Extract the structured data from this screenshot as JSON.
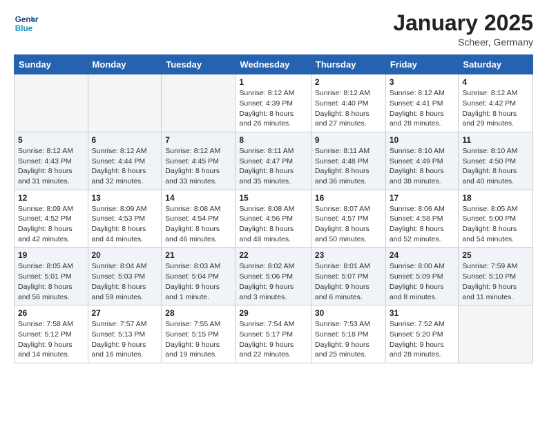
{
  "logo": {
    "line1": "General",
    "line2": "Blue"
  },
  "title": "January 2025",
  "subtitle": "Scheer, Germany",
  "weekdays": [
    "Sunday",
    "Monday",
    "Tuesday",
    "Wednesday",
    "Thursday",
    "Friday",
    "Saturday"
  ],
  "weeks": [
    [
      {
        "day": "",
        "info": ""
      },
      {
        "day": "",
        "info": ""
      },
      {
        "day": "",
        "info": ""
      },
      {
        "day": "1",
        "info": "Sunrise: 8:12 AM\nSunset: 4:39 PM\nDaylight: 8 hours and 26 minutes."
      },
      {
        "day": "2",
        "info": "Sunrise: 8:12 AM\nSunset: 4:40 PM\nDaylight: 8 hours and 27 minutes."
      },
      {
        "day": "3",
        "info": "Sunrise: 8:12 AM\nSunset: 4:41 PM\nDaylight: 8 hours and 28 minutes."
      },
      {
        "day": "4",
        "info": "Sunrise: 8:12 AM\nSunset: 4:42 PM\nDaylight: 8 hours and 29 minutes."
      }
    ],
    [
      {
        "day": "5",
        "info": "Sunrise: 8:12 AM\nSunset: 4:43 PM\nDaylight: 8 hours and 31 minutes."
      },
      {
        "day": "6",
        "info": "Sunrise: 8:12 AM\nSunset: 4:44 PM\nDaylight: 8 hours and 32 minutes."
      },
      {
        "day": "7",
        "info": "Sunrise: 8:12 AM\nSunset: 4:45 PM\nDaylight: 8 hours and 33 minutes."
      },
      {
        "day": "8",
        "info": "Sunrise: 8:11 AM\nSunset: 4:47 PM\nDaylight: 8 hours and 35 minutes."
      },
      {
        "day": "9",
        "info": "Sunrise: 8:11 AM\nSunset: 4:48 PM\nDaylight: 8 hours and 36 minutes."
      },
      {
        "day": "10",
        "info": "Sunrise: 8:10 AM\nSunset: 4:49 PM\nDaylight: 8 hours and 38 minutes."
      },
      {
        "day": "11",
        "info": "Sunrise: 8:10 AM\nSunset: 4:50 PM\nDaylight: 8 hours and 40 minutes."
      }
    ],
    [
      {
        "day": "12",
        "info": "Sunrise: 8:09 AM\nSunset: 4:52 PM\nDaylight: 8 hours and 42 minutes."
      },
      {
        "day": "13",
        "info": "Sunrise: 8:09 AM\nSunset: 4:53 PM\nDaylight: 8 hours and 44 minutes."
      },
      {
        "day": "14",
        "info": "Sunrise: 8:08 AM\nSunset: 4:54 PM\nDaylight: 8 hours and 46 minutes."
      },
      {
        "day": "15",
        "info": "Sunrise: 8:08 AM\nSunset: 4:56 PM\nDaylight: 8 hours and 48 minutes."
      },
      {
        "day": "16",
        "info": "Sunrise: 8:07 AM\nSunset: 4:57 PM\nDaylight: 8 hours and 50 minutes."
      },
      {
        "day": "17",
        "info": "Sunrise: 8:06 AM\nSunset: 4:58 PM\nDaylight: 8 hours and 52 minutes."
      },
      {
        "day": "18",
        "info": "Sunrise: 8:05 AM\nSunset: 5:00 PM\nDaylight: 8 hours and 54 minutes."
      }
    ],
    [
      {
        "day": "19",
        "info": "Sunrise: 8:05 AM\nSunset: 5:01 PM\nDaylight: 8 hours and 56 minutes."
      },
      {
        "day": "20",
        "info": "Sunrise: 8:04 AM\nSunset: 5:03 PM\nDaylight: 8 hours and 59 minutes."
      },
      {
        "day": "21",
        "info": "Sunrise: 8:03 AM\nSunset: 5:04 PM\nDaylight: 9 hours and 1 minute."
      },
      {
        "day": "22",
        "info": "Sunrise: 8:02 AM\nSunset: 5:06 PM\nDaylight: 9 hours and 3 minutes."
      },
      {
        "day": "23",
        "info": "Sunrise: 8:01 AM\nSunset: 5:07 PM\nDaylight: 9 hours and 6 minutes."
      },
      {
        "day": "24",
        "info": "Sunrise: 8:00 AM\nSunset: 5:09 PM\nDaylight: 9 hours and 8 minutes."
      },
      {
        "day": "25",
        "info": "Sunrise: 7:59 AM\nSunset: 5:10 PM\nDaylight: 9 hours and 11 minutes."
      }
    ],
    [
      {
        "day": "26",
        "info": "Sunrise: 7:58 AM\nSunset: 5:12 PM\nDaylight: 9 hours and 14 minutes."
      },
      {
        "day": "27",
        "info": "Sunrise: 7:57 AM\nSunset: 5:13 PM\nDaylight: 9 hours and 16 minutes."
      },
      {
        "day": "28",
        "info": "Sunrise: 7:55 AM\nSunset: 5:15 PM\nDaylight: 9 hours and 19 minutes."
      },
      {
        "day": "29",
        "info": "Sunrise: 7:54 AM\nSunset: 5:17 PM\nDaylight: 9 hours and 22 minutes."
      },
      {
        "day": "30",
        "info": "Sunrise: 7:53 AM\nSunset: 5:18 PM\nDaylight: 9 hours and 25 minutes."
      },
      {
        "day": "31",
        "info": "Sunrise: 7:52 AM\nSunset: 5:20 PM\nDaylight: 9 hours and 28 minutes."
      },
      {
        "day": "",
        "info": ""
      }
    ]
  ]
}
